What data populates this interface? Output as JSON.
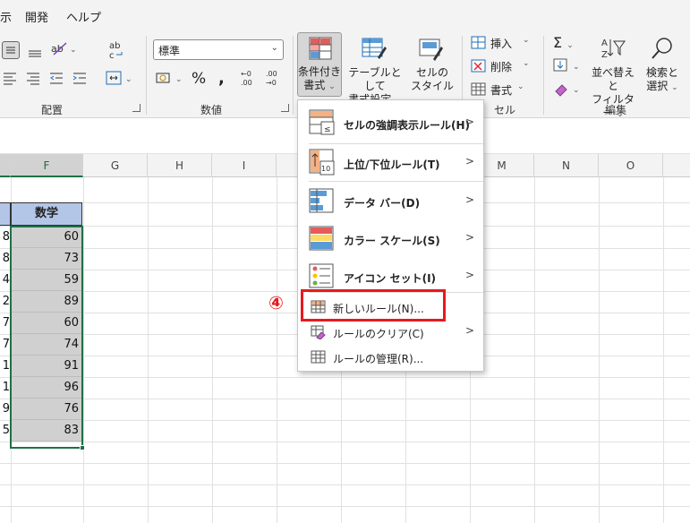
{
  "menu_tabs": [
    "示",
    "開発",
    "ヘルプ"
  ],
  "ribbon": {
    "number_format": "標準",
    "groups": {
      "alignment": "配置",
      "number": "数値",
      "cells": "セル",
      "editing": "編集"
    },
    "conditional_format": {
      "line1": "条件付き",
      "line2": "書式"
    },
    "format_as_table": {
      "line1": "テーブルとして",
      "line2": "書式設定"
    },
    "cell_styles": {
      "line1": "セルの",
      "line2": "スタイル"
    },
    "insert": "挿入",
    "delete": "削除",
    "format": "書式",
    "sort_filter": {
      "line1": "並べ替えと",
      "line2": "フィルター"
    },
    "find_select": {
      "line1": "検索と",
      "line2": "選択"
    }
  },
  "columns": [
    "F",
    "G",
    "H",
    "I",
    "M",
    "N",
    "O"
  ],
  "table": {
    "header": "数学",
    "rows": [
      {
        "e": "8",
        "f": "60"
      },
      {
        "e": "8",
        "f": "73"
      },
      {
        "e": "4",
        "f": "59"
      },
      {
        "e": "2",
        "f": "89"
      },
      {
        "e": "7",
        "f": "60"
      },
      {
        "e": "7",
        "f": "74"
      },
      {
        "e": "1",
        "f": "91"
      },
      {
        "e": "1",
        "f": "96"
      },
      {
        "e": "9",
        "f": "76"
      },
      {
        "e": "5",
        "f": "83"
      }
    ]
  },
  "cf_menu": {
    "highlight_rules": "セルの強調表示ルール(H)",
    "top_bottom_rules": "上位/下位ルール(T)",
    "data_bars": "データ バー(D)",
    "color_scales": "カラー スケール(S)",
    "icon_sets": "アイコン セット(I)",
    "new_rule": "新しいルール(N)...",
    "clear_rules": "ルールのクリア(C)",
    "manage_rules": "ルールの管理(R)...",
    "top_bottom_icon_text": "10"
  },
  "step_marker": "④",
  "colors": {
    "highlight": "#e8191e",
    "selection": "#1e7145"
  }
}
